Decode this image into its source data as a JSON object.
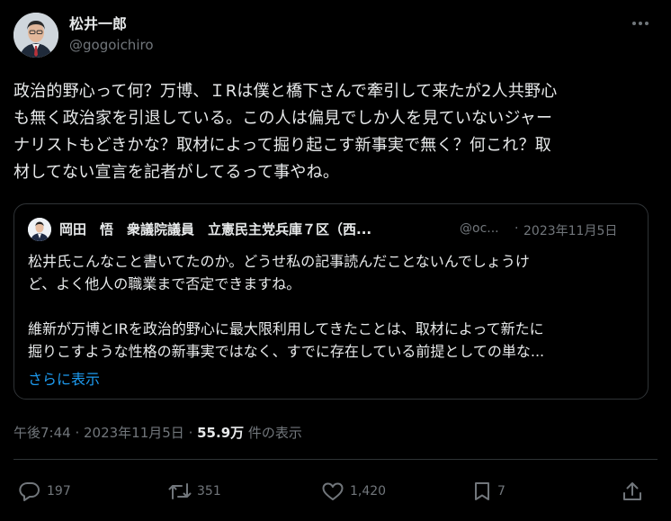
{
  "author": {
    "name": "松井一郎",
    "handle": "@gogoichiro"
  },
  "tweet": {
    "text": "政治的野心って何？万博、ＩRは僕と橋下さんで牽引して来たが2人共野心\nも無く政治家を引退している。この人は偏見でしか人を見ていないジャー\nナリストもどきかな？取材によって掘り起こす新事実で無く？何これ？取\n材してない宣言を記者がしてるって事やね。"
  },
  "quote": {
    "name": "岡田　悟　衆議院議員　立憲民主党兵庫７区（西...",
    "handle": "@oc...",
    "separator": "·",
    "date": "2023年11月5日",
    "text": "松井氏こんなこと書いてたのか。どうせ私の記事読んだことないんでしょうけ\nど、よく他人の職業まで否定できますね。\n\n維新が万博とIRを政治的野心に最大限利用してきたことは、取材によって新たに\n掘りこすような性格の新事実ではなく、すでに存在している前提としての単な...",
    "show_more": "さらに表示"
  },
  "meta": {
    "time": "午後7:44",
    "separator": " · ",
    "date": "2023年11月5日",
    "views_count": "55.9万",
    "views_label": " 件の表示"
  },
  "actions": {
    "replies": "197",
    "reposts": "351",
    "likes": "1,420",
    "bookmarks": "7"
  },
  "icons": {
    "more": "more-dots-icon",
    "reply": "reply-bubble-icon",
    "repost": "repost-arrows-icon",
    "like": "heart-icon",
    "bookmark": "bookmark-icon",
    "share": "share-upload-icon"
  },
  "colors": {
    "background": "#000000",
    "text": "#e7e9ea",
    "secondary": "#71767b",
    "border": "#2f3336",
    "link": "#1d9bf0"
  }
}
